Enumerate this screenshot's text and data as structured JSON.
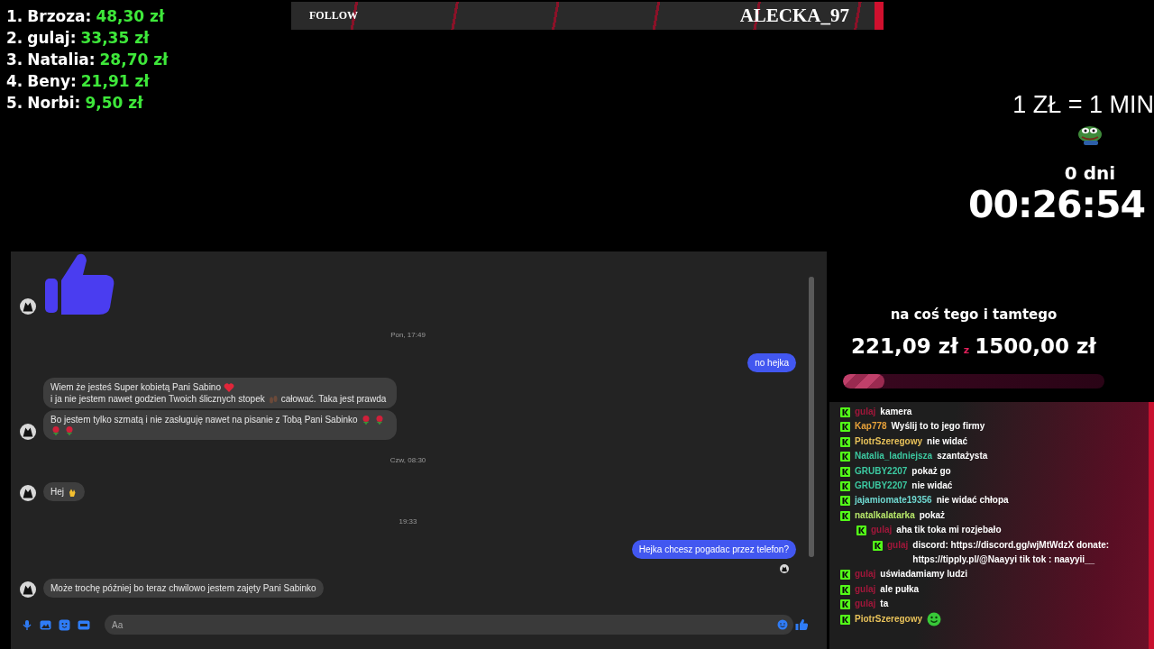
{
  "leaderboard": [
    {
      "rank": "1.",
      "name": "Brzoza:",
      "amount": "48,30 zł"
    },
    {
      "rank": "2.",
      "name": "gulaj:",
      "amount": "33,35 zł"
    },
    {
      "rank": "3.",
      "name": "Natalia:",
      "amount": "28,70 zł"
    },
    {
      "rank": "4.",
      "name": "Beny:",
      "amount": "21,91 zł"
    },
    {
      "rank": "5.",
      "name": "Norbi:",
      "amount": "9,50 zł"
    }
  ],
  "follow_bar": {
    "label": "FOLLOW",
    "name": "ALECKA_97"
  },
  "timer": {
    "rate": "1 ZŁ = 1 MIN",
    "days": "0 dni",
    "time": "00:26:54"
  },
  "goal": {
    "title": "na coś tego i tamtego",
    "current": "221,09 zł",
    "separator": "z",
    "target": "1500,00 zł",
    "level": 0.16
  },
  "messenger": {
    "messages": [
      {
        "kind": "thumb"
      },
      {
        "kind": "date",
        "text": "Pon, 17:49"
      },
      {
        "kind": "outgoing",
        "text": "no hejka",
        "seen": false
      },
      {
        "kind": "incoming",
        "bubbles": [
          [
            {
              "kind": "text",
              "text": "Wiem że jesteś Super kobietą Pani Sabino"
            },
            {
              "kind": "heart"
            },
            {
              "kind": "text",
              "text": "i ja nie jestem nawet godzien  Twoich ślicznych stopek"
            },
            {
              "kind": "feet"
            },
            {
              "kind": "text",
              "text": "całować.  Taka jest prawda"
            }
          ],
          [
            {
              "kind": "text",
              "text": "Bo jestem tylko szmatą i nie zasługuję  nawet na pisanie z Tobą Pani Sabinko"
            },
            {
              "kind": "rose"
            },
            {
              "kind": "rose"
            },
            {
              "kind": "rose"
            },
            {
              "kind": "rose"
            }
          ]
        ]
      },
      {
        "kind": "date",
        "text": "Czw, 08:30"
      },
      {
        "kind": "incoming",
        "bubbles": [
          [
            {
              "kind": "text",
              "text": "Hej"
            },
            {
              "kind": "wave"
            }
          ]
        ]
      },
      {
        "kind": "date",
        "text": "19:33"
      },
      {
        "kind": "outgoing",
        "text": "Hejka chcesz pogadac przez telefon?",
        "seen": true
      },
      {
        "kind": "incoming",
        "bubbles": [
          [
            {
              "kind": "text",
              "text": "Może  trochę później bo teraz chwilowo jestem zajęty  Pani Sabinko"
            }
          ]
        ]
      }
    ],
    "composer": {
      "placeholder": "Aa"
    }
  },
  "chat": [
    {
      "user": "gulaj",
      "color": "#a0173a",
      "text": "kamera"
    },
    {
      "user": "Kap778",
      "color": "#e8a23a",
      "text": "Wyślij to to jego firmy"
    },
    {
      "user": "PiotrSzeregowy",
      "color": "#e8c25a",
      "text": "nie widać"
    },
    {
      "user": "Natalia_ladniejsza",
      "color": "#3cc8a0",
      "text": "szantażysta"
    },
    {
      "user": "GRUBY2207",
      "color": "#3cc8a0",
      "text": "pokaż go"
    },
    {
      "user": "GRUBY2207",
      "color": "#3cc8a0",
      "text": "nie widać"
    },
    {
      "user": "jajamiomate19356",
      "color": "#6fd8d0",
      "text": "nie widać chłopa"
    },
    {
      "user": "natalkalatarka",
      "color": "#b8e86a",
      "text": "pokaż",
      "children": [
        {
          "user": "gulaj",
          "color": "#a0173a",
          "text": "aha tik toka mi rozjebało",
          "children": [
            {
              "user": "gulaj",
              "color": "#a0173a",
              "text": "discord: https://discord.gg/wjMtWdzX donate: https://tipply.pl/@Naayyi tik tok : naayyii__"
            }
          ]
        }
      ]
    },
    {
      "user": "gulaj",
      "color": "#a0173a",
      "text": "uświadamiamy ludzi"
    },
    {
      "user": "gulaj",
      "color": "#a0173a",
      "text": "ale pułka"
    },
    {
      "user": "gulaj",
      "color": "#a0173a",
      "text": "ta"
    },
    {
      "user": "PiotrSzeregowy",
      "color": "#e8c25a",
      "kind": "smile_emote"
    }
  ]
}
